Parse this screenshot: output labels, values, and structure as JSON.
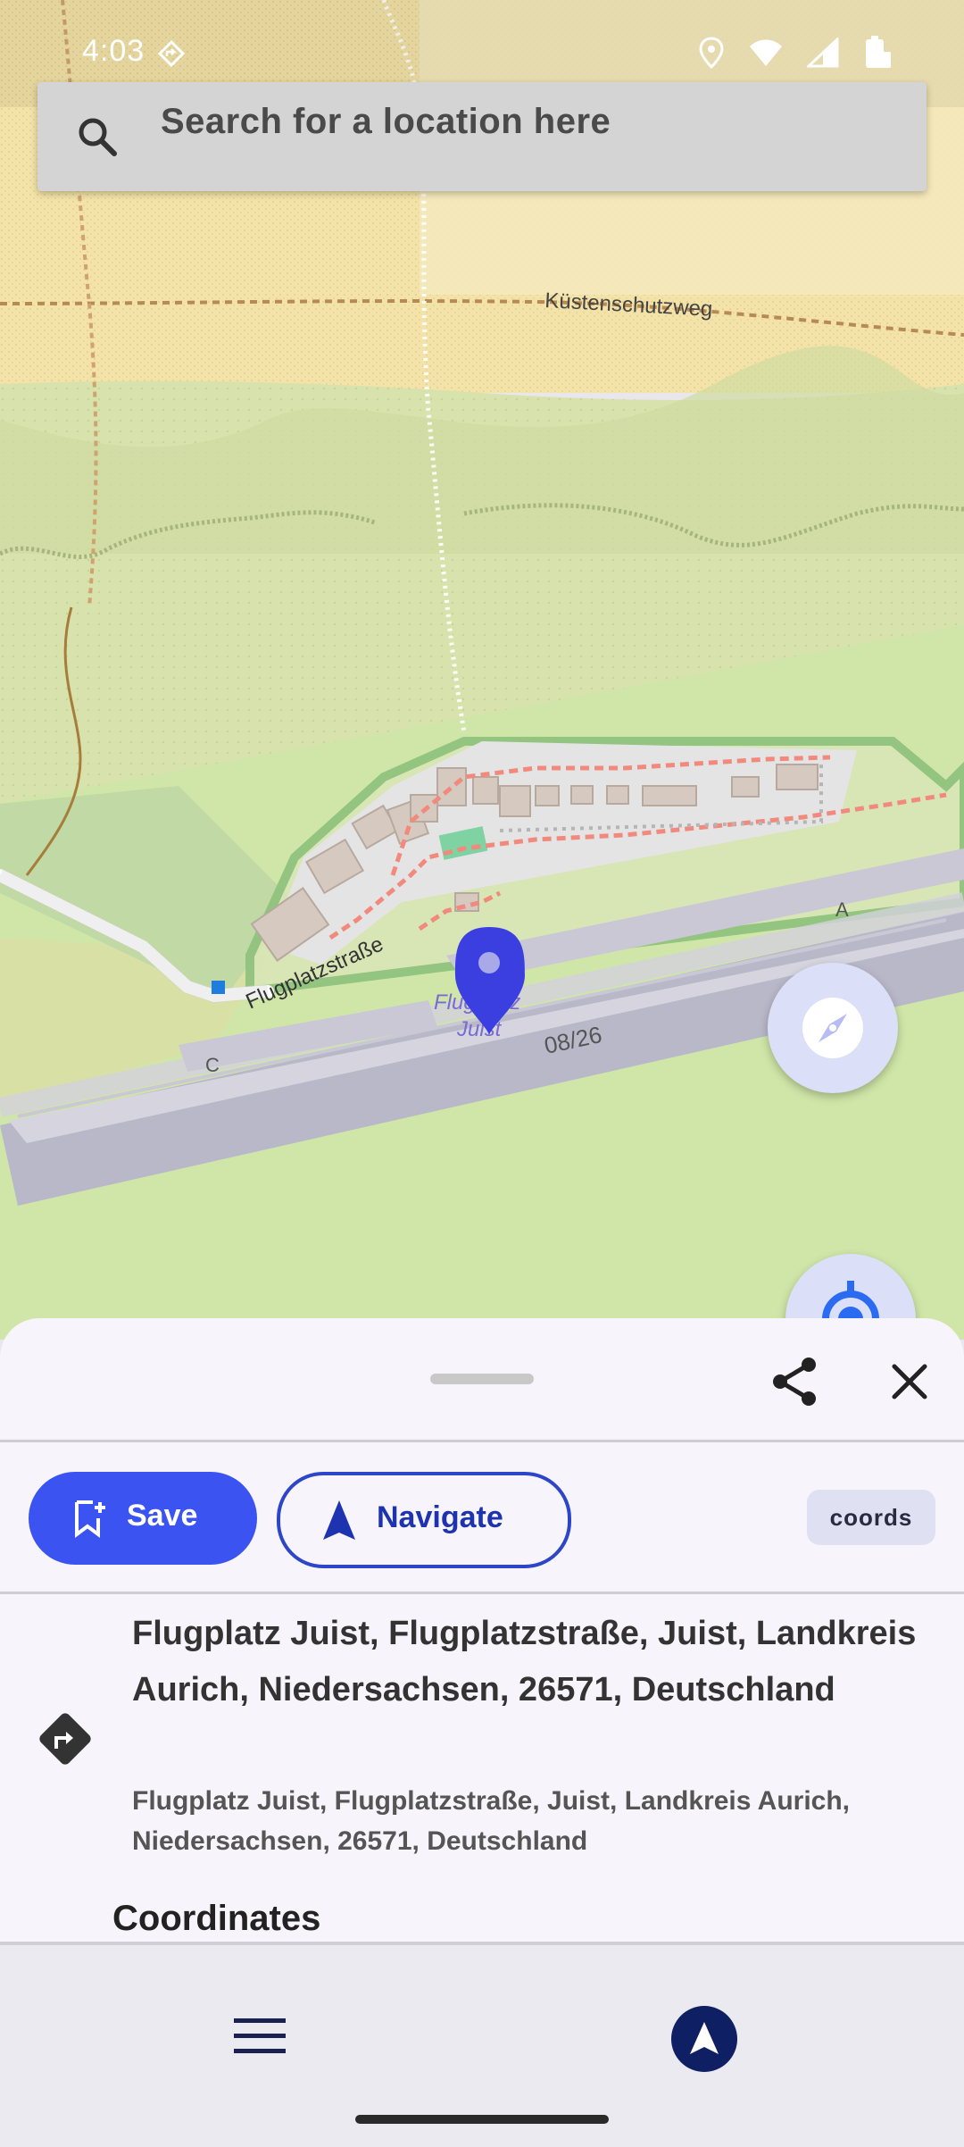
{
  "status_bar": {
    "time": "4:03"
  },
  "search": {
    "placeholder": "Search for a location here"
  },
  "map": {
    "labels": {
      "street_north": "Küstenschutzweg",
      "street_airport": "Flugplatzstraße",
      "airport_name_1": "Flugplatz",
      "airport_name_2": "Juist",
      "runway": "08/26",
      "taxiway_a": "A",
      "taxiway_c": "C"
    }
  },
  "sheet": {
    "save_label": "Save",
    "navigate_label": "Navigate",
    "coords_chip": "coords",
    "address_title": "Flugplatz Juist, Flugplatzstraße, Juist, Landkreis Aurich, Niedersachsen, 26571, Deutschland",
    "address_subtitle": "Flugplatz Juist, Flugplatzstraße, Juist, Landkreis Aurich, Niedersachsen, 26571, Deutschland",
    "coordinates_heading": "Coordinates"
  },
  "colors": {
    "accent": "#3b54f1",
    "nav_fab": "#0e1f63",
    "map_sand": "#f3e7b4",
    "map_grass": "#d5e7b2"
  },
  "icons": [
    "search-icon",
    "gps-icon",
    "wifi-icon",
    "signal-icon",
    "battery-icon",
    "compass-icon",
    "my-location-icon",
    "share-icon",
    "close-icon",
    "bookmark-add-icon",
    "navigation-arrow-icon",
    "turn-right-icon",
    "menu-icon"
  ]
}
